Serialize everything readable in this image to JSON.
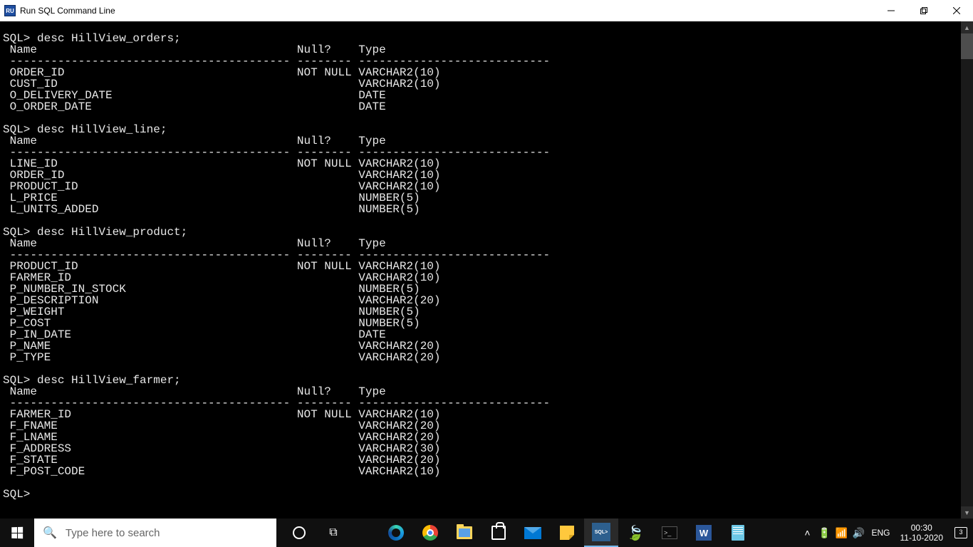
{
  "window": {
    "title": "Run SQL Command Line",
    "icon_label": "RU"
  },
  "prompt": "SQL>",
  "blocks": [
    {
      "command": "desc HillView_orders;",
      "headers": {
        "name": "Name",
        "null": "Null?",
        "type": "Type"
      },
      "rows": [
        {
          "name": "ORDER_ID",
          "null": "NOT NULL",
          "type": "VARCHAR2(10)"
        },
        {
          "name": "CUST_ID",
          "null": "",
          "type": "VARCHAR2(10)"
        },
        {
          "name": "O_DELIVERY_DATE",
          "null": "",
          "type": "DATE"
        },
        {
          "name": "O_ORDER_DATE",
          "null": "",
          "type": "DATE"
        }
      ]
    },
    {
      "command": "desc HillView_line;",
      "headers": {
        "name": "Name",
        "null": "Null?",
        "type": "Type"
      },
      "rows": [
        {
          "name": "LINE_ID",
          "null": "NOT NULL",
          "type": "VARCHAR2(10)"
        },
        {
          "name": "ORDER_ID",
          "null": "",
          "type": "VARCHAR2(10)"
        },
        {
          "name": "PRODUCT_ID",
          "null": "",
          "type": "VARCHAR2(10)"
        },
        {
          "name": "L_PRICE",
          "null": "",
          "type": "NUMBER(5)"
        },
        {
          "name": "L_UNITS_ADDED",
          "null": "",
          "type": "NUMBER(5)"
        }
      ]
    },
    {
      "command": "desc HillView_product;",
      "headers": {
        "name": "Name",
        "null": "Null?",
        "type": "Type"
      },
      "rows": [
        {
          "name": "PRODUCT_ID",
          "null": "NOT NULL",
          "type": "VARCHAR2(10)"
        },
        {
          "name": "FARMER_ID",
          "null": "",
          "type": "VARCHAR2(10)"
        },
        {
          "name": "P_NUMBER_IN_STOCK",
          "null": "",
          "type": "NUMBER(5)"
        },
        {
          "name": "P_DESCRIPTION",
          "null": "",
          "type": "VARCHAR2(20)"
        },
        {
          "name": "P_WEIGHT",
          "null": "",
          "type": "NUMBER(5)"
        },
        {
          "name": "P_COST",
          "null": "",
          "type": "NUMBER(5)"
        },
        {
          "name": "P_IN_DATE",
          "null": "",
          "type": "DATE"
        },
        {
          "name": "P_NAME",
          "null": "",
          "type": "VARCHAR2(20)"
        },
        {
          "name": "P_TYPE",
          "null": "",
          "type": "VARCHAR2(20)"
        }
      ]
    },
    {
      "command": "desc HillView_farmer;",
      "headers": {
        "name": "Name",
        "null": "Null?",
        "type": "Type"
      },
      "rows": [
        {
          "name": "FARMER_ID",
          "null": "NOT NULL",
          "type": "VARCHAR2(10)"
        },
        {
          "name": "F_FNAME",
          "null": "",
          "type": "VARCHAR2(20)"
        },
        {
          "name": "F_LNAME",
          "null": "",
          "type": "VARCHAR2(20)"
        },
        {
          "name": "F_ADDRESS",
          "null": "",
          "type": "VARCHAR2(30)"
        },
        {
          "name": "F_STATE",
          "null": "",
          "type": "VARCHAR2(20)"
        },
        {
          "name": "F_POST_CODE",
          "null": "",
          "type": "VARCHAR2(10)"
        }
      ]
    }
  ],
  "columns": {
    "name_dashes": "-----------------------------------------",
    "null_dashes": "--------",
    "type_dashes": "----------------------------",
    "name_w": 42,
    "null_w": 9
  },
  "taskbar": {
    "search_placeholder": "Type here to search",
    "sql_label": "SQL>",
    "lang": "ENG",
    "time": "00:30",
    "date": "11-10-2020",
    "notif_count": "3"
  }
}
